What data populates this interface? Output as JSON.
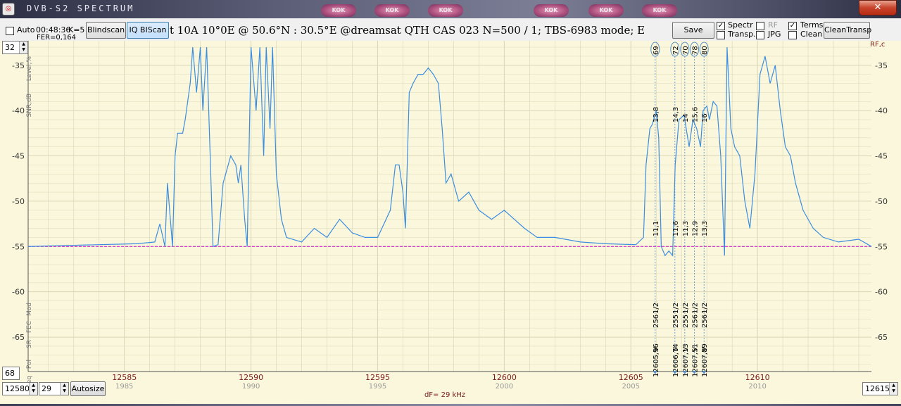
{
  "window": {
    "title": "DVB-S2  SPECTRUM",
    "close_glyph": "✕",
    "taskbar_buttons": [
      "KOK",
      "KOK",
      "KOK",
      "KOK",
      "KOK",
      "KOK"
    ]
  },
  "toolbar": {
    "auto_label": "Auto",
    "time": "00:48:36",
    "k_label": "K=5",
    "fer": "FER=0,164",
    "blindscan_label": "Blindscan",
    "iqbiscan_label": "IQ BIScan",
    "header": "t 10A    10°0E  @  50.6°N : 30.5°E     @dreamsat QTH CAS 023      N=500 / 1; TBS-6983 mode; E",
    "save_label": "Save",
    "spectr_label": "Spectr",
    "transp_label": "Transp.",
    "rf_label": "RF",
    "jpg_label": "JPG",
    "terms_label": "Terms",
    "clean_label": "Clean",
    "cleantransp_label": "CleanTransp",
    "spectr_checked": true,
    "transp_checked": false,
    "rf_checked": false,
    "jpg_checked": false,
    "terms_checked": true,
    "clean_checked": false
  },
  "controls": {
    "top_spin_value": "32",
    "bottom_spin_value": "68",
    "freq_start": "12580",
    "span_value": "29",
    "autosize_label": "Autosize",
    "freq_end": "12615",
    "df_label": "dF= 29 kHz"
  },
  "left_axis_labels": [
    "Level,%",
    "SNR,dB",
    "Mod",
    "FEC",
    "SR",
    "Pol",
    "Freq"
  ],
  "right_axis_label": "RF,c",
  "chart_data": {
    "type": "line",
    "xlim": [
      12581.2,
      12614.5
    ],
    "ylim": [
      -68.8,
      -32.3
    ],
    "y_ticks": [
      -35,
      -40,
      -45,
      -50,
      -55,
      -60,
      -65
    ],
    "x_ticks": [
      {
        "mhz": 12585,
        "label": "12585",
        "sub": "1985"
      },
      {
        "mhz": 12590,
        "label": "12590",
        "sub": "1990"
      },
      {
        "mhz": 12595,
        "label": "12595",
        "sub": "1995"
      },
      {
        "mhz": 12600,
        "label": "12600",
        "sub": "2000"
      },
      {
        "mhz": 12605,
        "label": "12605",
        "sub": "2005"
      },
      {
        "mhz": 12610,
        "label": "12610",
        "sub": "2010"
      }
    ],
    "noise_floor_db": -55,
    "series": [
      {
        "points": [
          [
            12581.2,
            -55
          ],
          [
            12584.0,
            -54.8
          ],
          [
            12585.5,
            -54.7
          ],
          [
            12586.2,
            -54.5
          ],
          [
            12586.4,
            -52.5
          ],
          [
            12586.6,
            -55
          ],
          [
            12586.7,
            -48
          ],
          [
            12586.9,
            -55
          ],
          [
            12587.0,
            -45
          ],
          [
            12587.1,
            -42.5
          ],
          [
            12587.3,
            -42.5
          ],
          [
            12587.4,
            -41
          ],
          [
            12587.6,
            -37
          ],
          [
            12587.7,
            -33
          ],
          [
            12587.85,
            -38
          ],
          [
            12588.0,
            -33
          ],
          [
            12588.1,
            -40
          ],
          [
            12588.25,
            -33
          ],
          [
            12588.4,
            -46
          ],
          [
            12588.5,
            -55
          ],
          [
            12588.7,
            -54.8
          ],
          [
            12588.9,
            -48
          ],
          [
            12589.0,
            -47
          ],
          [
            12589.2,
            -45
          ],
          [
            12589.4,
            -46
          ],
          [
            12589.5,
            -48
          ],
          [
            12589.6,
            -46
          ],
          [
            12589.75,
            -52
          ],
          [
            12589.85,
            -55
          ],
          [
            12590.0,
            -33
          ],
          [
            12590.2,
            -40
          ],
          [
            12590.35,
            -33
          ],
          [
            12590.5,
            -45
          ],
          [
            12590.6,
            -33
          ],
          [
            12590.75,
            -42
          ],
          [
            12590.85,
            -33
          ],
          [
            12591.0,
            -47
          ],
          [
            12591.2,
            -52
          ],
          [
            12591.4,
            -54
          ],
          [
            12592.0,
            -54.5
          ],
          [
            12592.5,
            -53
          ],
          [
            12593.0,
            -54
          ],
          [
            12593.5,
            -52
          ],
          [
            12594.0,
            -53.5
          ],
          [
            12594.5,
            -54
          ],
          [
            12595.0,
            -54
          ],
          [
            12595.5,
            -51
          ],
          [
            12595.7,
            -46
          ],
          [
            12595.85,
            -46
          ],
          [
            12596.0,
            -49
          ],
          [
            12596.1,
            -53
          ],
          [
            12596.25,
            -38
          ],
          [
            12596.4,
            -37
          ],
          [
            12596.6,
            -36
          ],
          [
            12596.8,
            -36
          ],
          [
            12597.0,
            -35.3
          ],
          [
            12597.2,
            -36
          ],
          [
            12597.4,
            -37
          ],
          [
            12597.55,
            -42
          ],
          [
            12597.7,
            -48
          ],
          [
            12597.9,
            -47
          ],
          [
            12598.2,
            -50
          ],
          [
            12598.6,
            -49
          ],
          [
            12599.0,
            -51
          ],
          [
            12599.5,
            -52
          ],
          [
            12600.0,
            -51
          ],
          [
            12600.4,
            -52
          ],
          [
            12600.8,
            -53
          ],
          [
            12601.3,
            -54
          ],
          [
            12602.0,
            -54
          ],
          [
            12603.0,
            -54.5
          ],
          [
            12604.0,
            -54.7
          ],
          [
            12605.2,
            -54.8
          ],
          [
            12605.5,
            -54
          ],
          [
            12605.6,
            -46
          ],
          [
            12605.75,
            -42
          ],
          [
            12605.85,
            -41.5
          ],
          [
            12606.0,
            -40
          ],
          [
            12606.1,
            -43
          ],
          [
            12606.2,
            -55
          ],
          [
            12606.35,
            -56
          ],
          [
            12606.5,
            -55.5
          ],
          [
            12606.65,
            -56
          ],
          [
            12606.75,
            -46
          ],
          [
            12606.9,
            -41
          ],
          [
            12607.1,
            -40.5
          ],
          [
            12607.3,
            -44
          ],
          [
            12607.45,
            -41
          ],
          [
            12607.6,
            -42
          ],
          [
            12607.75,
            -44
          ],
          [
            12607.85,
            -40
          ],
          [
            12608.0,
            -39.5
          ],
          [
            12608.1,
            -41
          ],
          [
            12608.25,
            -39
          ],
          [
            12608.4,
            -39.5
          ],
          [
            12608.55,
            -45
          ],
          [
            12608.7,
            -56
          ],
          [
            12608.8,
            -33
          ],
          [
            12608.95,
            -42
          ],
          [
            12609.1,
            -44
          ],
          [
            12609.3,
            -45
          ],
          [
            12609.5,
            -50
          ],
          [
            12609.7,
            -53
          ],
          [
            12609.9,
            -47
          ],
          [
            12610.1,
            -36
          ],
          [
            12610.3,
            -34
          ],
          [
            12610.5,
            -37
          ],
          [
            12610.7,
            -35
          ],
          [
            12610.9,
            -40
          ],
          [
            12611.1,
            -44
          ],
          [
            12611.3,
            -45
          ],
          [
            12611.5,
            -48
          ],
          [
            12611.8,
            -51
          ],
          [
            12612.2,
            -53
          ],
          [
            12612.6,
            -54
          ],
          [
            12613.2,
            -54.5
          ],
          [
            12614.0,
            -54.2
          ],
          [
            12614.5,
            -55
          ]
        ]
      }
    ],
    "transponders": [
      {
        "mhz": 12605.96,
        "id": "69",
        "level": "13,8",
        "snr": "11,1",
        "mod": "256",
        "fec": "1/2",
        "pol": "V",
        "freq": "12605,96"
      },
      {
        "mhz": 12606.74,
        "id": "72",
        "level": "14,3",
        "snr": "11,6",
        "mod": "255",
        "fec": "1/2",
        "pol": "V",
        "freq": "12606,74"
      },
      {
        "mhz": 12607.13,
        "id": "70",
        "level": "14",
        "snr": "11,3",
        "mod": "255",
        "fec": "1/2",
        "pol": "V",
        "freq": "12607,13"
      },
      {
        "mhz": 12607.51,
        "id": "78",
        "level": "15,6",
        "snr": "12,9",
        "mod": "256",
        "fec": "1/2",
        "pol": "V",
        "freq": "12607,51"
      },
      {
        "mhz": 12607.89,
        "id": "80",
        "level": "16",
        "snr": "13,3",
        "mod": "256",
        "fec": "1/2",
        "pol": "V",
        "freq": "12607,89"
      }
    ]
  },
  "colors": {
    "plot_background": "#fbf7dc",
    "trace": "#3c8de0",
    "floor_line": "#cc33cc",
    "grid": "#d9d5b5",
    "axis_dark_red": "#7a1a1a",
    "marker": "#5590c8"
  }
}
